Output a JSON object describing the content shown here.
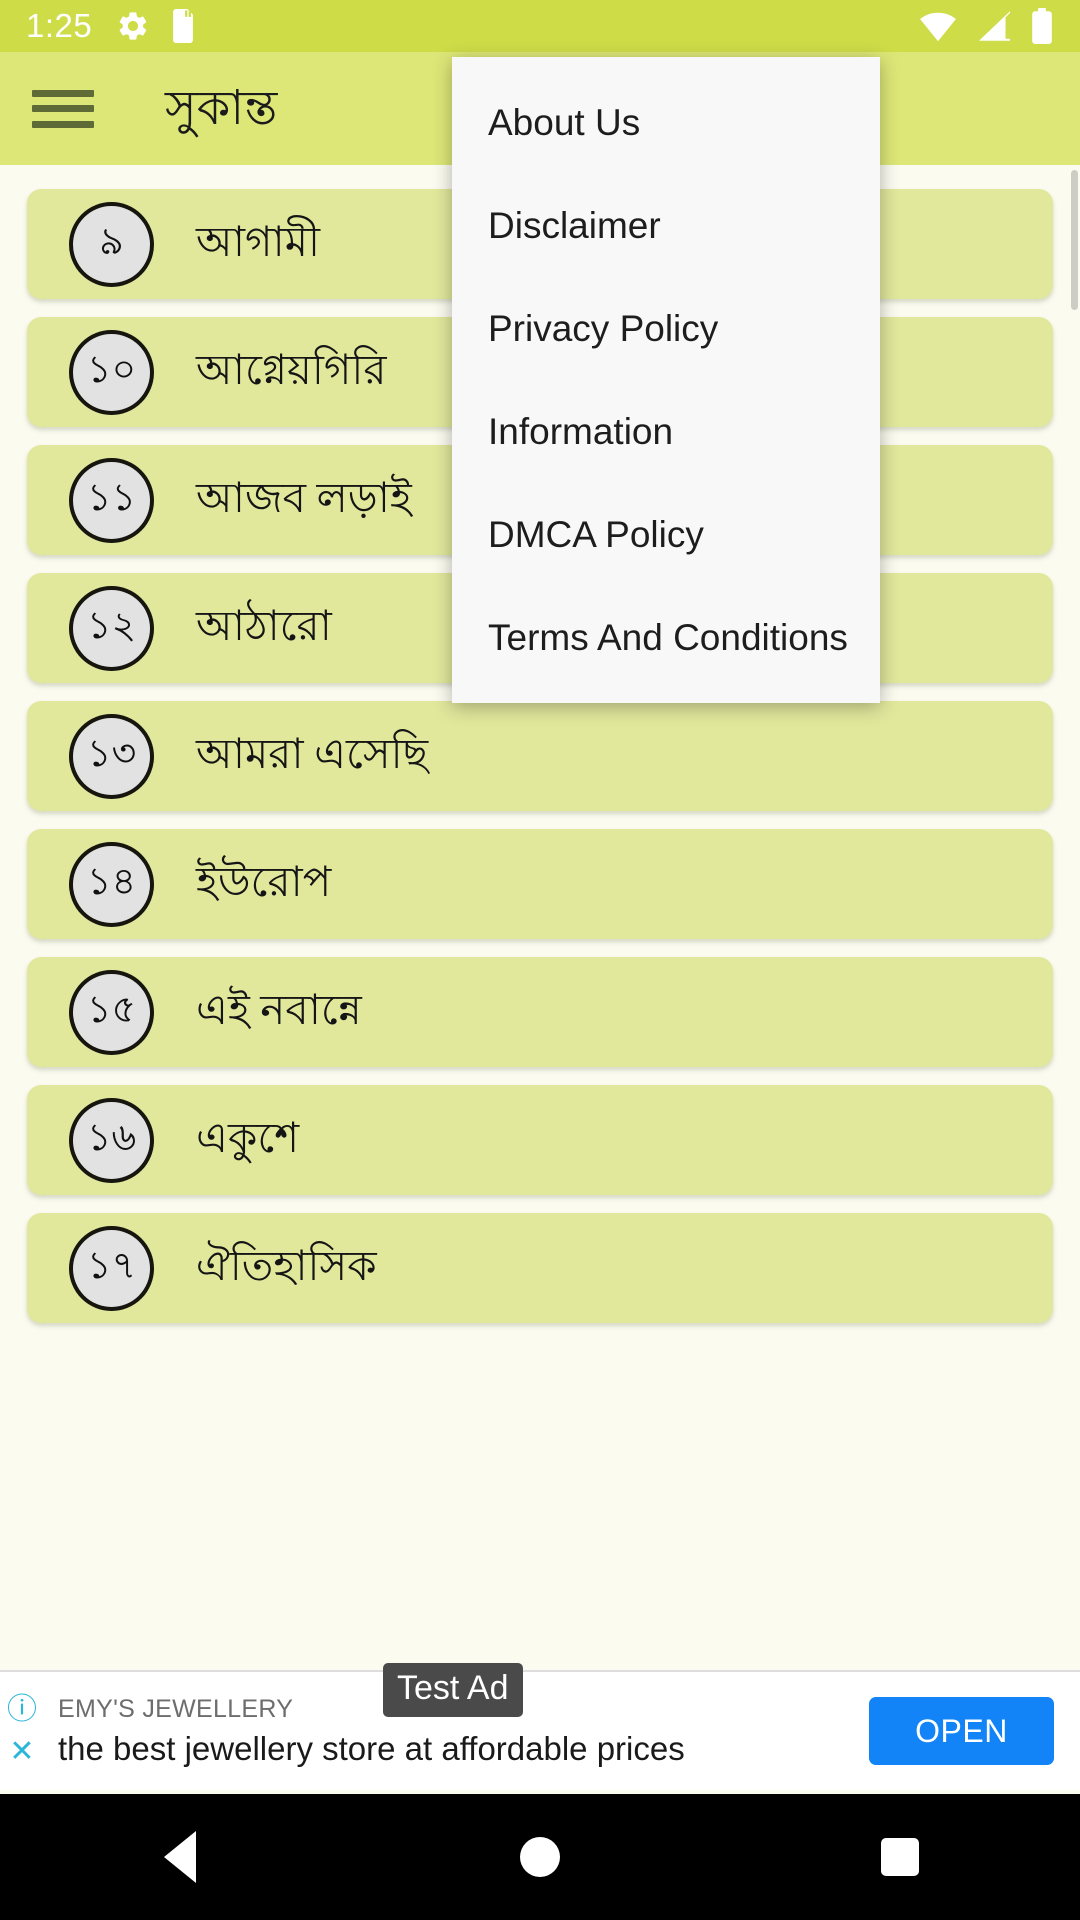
{
  "status_bar": {
    "clock": "1:25",
    "left_icons": [
      "gear-icon",
      "sd-card-icon"
    ],
    "right_icons": [
      "wifi-icon",
      "cellular-signal-icon",
      "battery-icon"
    ],
    "background": "#cedc48"
  },
  "app_bar": {
    "title": "সুকান্ত",
    "menu_icon": "hamburger-icon",
    "background": "#dde777"
  },
  "overflow_menu": {
    "items": [
      {
        "label": "About Us"
      },
      {
        "label": "Disclaimer"
      },
      {
        "label": "Privacy Policy"
      },
      {
        "label": "Information"
      },
      {
        "label": "DMCA Policy"
      },
      {
        "label": "Terms And Conditions"
      }
    ],
    "background": "#f8f8f8"
  },
  "chapter_list": {
    "row_color": "#e1e89c",
    "badge_color": "#e2e2e2",
    "items": [
      {
        "number": "৯",
        "title": "আগামী"
      },
      {
        "number": "১০",
        "title": "আগ্নেয়গিরি"
      },
      {
        "number": "১১",
        "title": "আজব লড়াই"
      },
      {
        "number": "১২",
        "title": "আঠারো"
      },
      {
        "number": "১৩",
        "title": "আমরা এসেছি"
      },
      {
        "number": "১৪",
        "title": "ইউরোপ"
      },
      {
        "number": "১৫",
        "title": "এই নবান্নে"
      },
      {
        "number": "১৬",
        "title": "একুশে"
      },
      {
        "number": "১৭",
        "title": "ঐতিহাসিক"
      }
    ]
  },
  "ad_banner": {
    "test_label": "Test Ad",
    "advertiser": "EMY'S JEWELLERY",
    "headline": "the best jewellery store at affordable prices",
    "cta_label": "OPEN",
    "cta_color": "#1284f7",
    "info_glyph": "ⓘ",
    "close_glyph": "✕"
  },
  "nav_bar": {
    "buttons": [
      "back-button",
      "home-button",
      "recents-button"
    ],
    "background": "#000000"
  }
}
